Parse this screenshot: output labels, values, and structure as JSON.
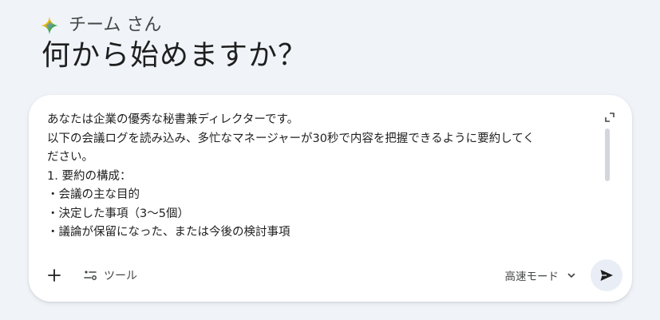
{
  "greeting": {
    "name": "チーム さん",
    "icon": "sparkle-icon"
  },
  "headline": "何から始めますか？",
  "prompt": {
    "lines": [
      "あなたは企業の優秀な秘書兼ディレクターです。",
      "以下の会議ログを読み込み、多忙なマネージャーが30秒で内容を把握できるように要約してく",
      "ださい。",
      "1. 要約の構成：",
      "・会議の主な目的",
      "・決定した事項（3〜5個）",
      "・議論が保留になった、または今後の検討事項"
    ]
  },
  "toolbar": {
    "add_icon": "plus-icon",
    "tools_icon": "tools-icon",
    "tools_label": "ツール",
    "mode_label": "高速モード",
    "mode_icon": "chevron-down-icon",
    "send_icon": "send-icon"
  },
  "colors": {
    "background": "#f0f4f9",
    "card": "#ffffff",
    "send_bg": "#e9eef6",
    "spark_blue": "#4285f4",
    "spark_red": "#ea4335",
    "spark_yellow": "#fbbc04",
    "spark_green": "#34a853"
  }
}
